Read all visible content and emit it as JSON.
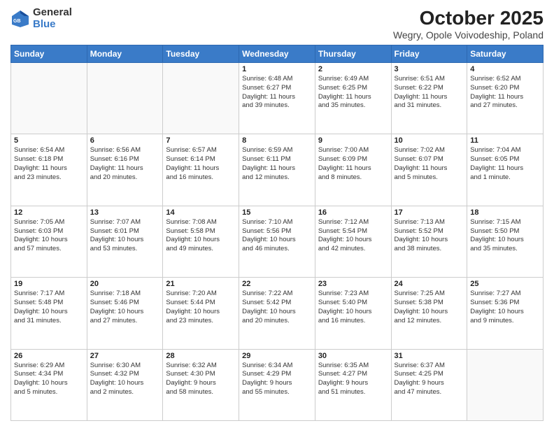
{
  "header": {
    "logo_general": "General",
    "logo_blue": "Blue",
    "month_title": "October 2025",
    "location": "Wegry, Opole Voivodeship, Poland"
  },
  "weekdays": [
    "Sunday",
    "Monday",
    "Tuesday",
    "Wednesday",
    "Thursday",
    "Friday",
    "Saturday"
  ],
  "weeks": [
    [
      {
        "day": "",
        "info": ""
      },
      {
        "day": "",
        "info": ""
      },
      {
        "day": "",
        "info": ""
      },
      {
        "day": "1",
        "info": "Sunrise: 6:48 AM\nSunset: 6:27 PM\nDaylight: 11 hours\nand 39 minutes."
      },
      {
        "day": "2",
        "info": "Sunrise: 6:49 AM\nSunset: 6:25 PM\nDaylight: 11 hours\nand 35 minutes."
      },
      {
        "day": "3",
        "info": "Sunrise: 6:51 AM\nSunset: 6:22 PM\nDaylight: 11 hours\nand 31 minutes."
      },
      {
        "day": "4",
        "info": "Sunrise: 6:52 AM\nSunset: 6:20 PM\nDaylight: 11 hours\nand 27 minutes."
      }
    ],
    [
      {
        "day": "5",
        "info": "Sunrise: 6:54 AM\nSunset: 6:18 PM\nDaylight: 11 hours\nand 23 minutes."
      },
      {
        "day": "6",
        "info": "Sunrise: 6:56 AM\nSunset: 6:16 PM\nDaylight: 11 hours\nand 20 minutes."
      },
      {
        "day": "7",
        "info": "Sunrise: 6:57 AM\nSunset: 6:14 PM\nDaylight: 11 hours\nand 16 minutes."
      },
      {
        "day": "8",
        "info": "Sunrise: 6:59 AM\nSunset: 6:11 PM\nDaylight: 11 hours\nand 12 minutes."
      },
      {
        "day": "9",
        "info": "Sunrise: 7:00 AM\nSunset: 6:09 PM\nDaylight: 11 hours\nand 8 minutes."
      },
      {
        "day": "10",
        "info": "Sunrise: 7:02 AM\nSunset: 6:07 PM\nDaylight: 11 hours\nand 5 minutes."
      },
      {
        "day": "11",
        "info": "Sunrise: 7:04 AM\nSunset: 6:05 PM\nDaylight: 11 hours\nand 1 minute."
      }
    ],
    [
      {
        "day": "12",
        "info": "Sunrise: 7:05 AM\nSunset: 6:03 PM\nDaylight: 10 hours\nand 57 minutes."
      },
      {
        "day": "13",
        "info": "Sunrise: 7:07 AM\nSunset: 6:01 PM\nDaylight: 10 hours\nand 53 minutes."
      },
      {
        "day": "14",
        "info": "Sunrise: 7:08 AM\nSunset: 5:58 PM\nDaylight: 10 hours\nand 49 minutes."
      },
      {
        "day": "15",
        "info": "Sunrise: 7:10 AM\nSunset: 5:56 PM\nDaylight: 10 hours\nand 46 minutes."
      },
      {
        "day": "16",
        "info": "Sunrise: 7:12 AM\nSunset: 5:54 PM\nDaylight: 10 hours\nand 42 minutes."
      },
      {
        "day": "17",
        "info": "Sunrise: 7:13 AM\nSunset: 5:52 PM\nDaylight: 10 hours\nand 38 minutes."
      },
      {
        "day": "18",
        "info": "Sunrise: 7:15 AM\nSunset: 5:50 PM\nDaylight: 10 hours\nand 35 minutes."
      }
    ],
    [
      {
        "day": "19",
        "info": "Sunrise: 7:17 AM\nSunset: 5:48 PM\nDaylight: 10 hours\nand 31 minutes."
      },
      {
        "day": "20",
        "info": "Sunrise: 7:18 AM\nSunset: 5:46 PM\nDaylight: 10 hours\nand 27 minutes."
      },
      {
        "day": "21",
        "info": "Sunrise: 7:20 AM\nSunset: 5:44 PM\nDaylight: 10 hours\nand 23 minutes."
      },
      {
        "day": "22",
        "info": "Sunrise: 7:22 AM\nSunset: 5:42 PM\nDaylight: 10 hours\nand 20 minutes."
      },
      {
        "day": "23",
        "info": "Sunrise: 7:23 AM\nSunset: 5:40 PM\nDaylight: 10 hours\nand 16 minutes."
      },
      {
        "day": "24",
        "info": "Sunrise: 7:25 AM\nSunset: 5:38 PM\nDaylight: 10 hours\nand 12 minutes."
      },
      {
        "day": "25",
        "info": "Sunrise: 7:27 AM\nSunset: 5:36 PM\nDaylight: 10 hours\nand 9 minutes."
      }
    ],
    [
      {
        "day": "26",
        "info": "Sunrise: 6:29 AM\nSunset: 4:34 PM\nDaylight: 10 hours\nand 5 minutes."
      },
      {
        "day": "27",
        "info": "Sunrise: 6:30 AM\nSunset: 4:32 PM\nDaylight: 10 hours\nand 2 minutes."
      },
      {
        "day": "28",
        "info": "Sunrise: 6:32 AM\nSunset: 4:30 PM\nDaylight: 9 hours\nand 58 minutes."
      },
      {
        "day": "29",
        "info": "Sunrise: 6:34 AM\nSunset: 4:29 PM\nDaylight: 9 hours\nand 55 minutes."
      },
      {
        "day": "30",
        "info": "Sunrise: 6:35 AM\nSunset: 4:27 PM\nDaylight: 9 hours\nand 51 minutes."
      },
      {
        "day": "31",
        "info": "Sunrise: 6:37 AM\nSunset: 4:25 PM\nDaylight: 9 hours\nand 47 minutes."
      },
      {
        "day": "",
        "info": ""
      }
    ]
  ]
}
